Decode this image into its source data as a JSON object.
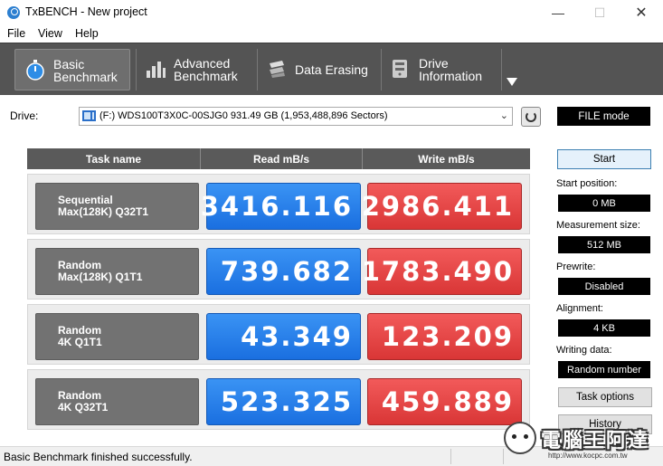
{
  "window": {
    "title": "TxBENCH - New project",
    "min_glyph": "—",
    "max_glyph": "☐",
    "close_glyph": "✕"
  },
  "menu": {
    "items": [
      "File",
      "View",
      "Help"
    ]
  },
  "toolbar": {
    "buttons": [
      {
        "label": "Basic\nBenchmark",
        "icon": "stopwatch-icon",
        "active": true
      },
      {
        "label": "Advanced\nBenchmark",
        "icon": "bar-chart-icon",
        "active": false
      },
      {
        "label": "Data Erasing",
        "icon": "eraser-icon",
        "active": false
      },
      {
        "label": "Drive\nInformation",
        "icon": "drive-info-icon",
        "active": false
      }
    ],
    "more_icon": "chevron-down-icon"
  },
  "drive": {
    "label": "Drive:",
    "selected": "(F:) WDS100T3X0C-00SJG0  931.49 GB (1,953,488,896 Sectors)",
    "mode": "FILE mode"
  },
  "table": {
    "headers": [
      "Task name",
      "Read mB/s",
      "Write mB/s"
    ],
    "rows": [
      {
        "name": "Sequential\nMax(128K) Q32T1",
        "read": "3416.116",
        "write": "2986.411"
      },
      {
        "name": "Random\nMax(128K) Q1T1",
        "read": "739.682",
        "write": "1783.490"
      },
      {
        "name": "Random\n4K Q1T1",
        "read": "43.349",
        "write": "123.209"
      },
      {
        "name": "Random\n4K Q32T1",
        "read": "523.325",
        "write": "459.889"
      }
    ]
  },
  "panel": {
    "start_label": "Start",
    "start_position_label": "Start position:",
    "start_position_value": "0 MB",
    "measurement_size_label": "Measurement size:",
    "measurement_size_value": "512 MB",
    "prewrite_label": "Prewrite:",
    "prewrite_value": "Disabled",
    "alignment_label": "Alignment:",
    "alignment_value": "4 KB",
    "writing_data_label": "Writing data:",
    "writing_data_value": "Random number",
    "task_options_label": "Task options",
    "history_label": "History"
  },
  "status": {
    "text": "Basic Benchmark finished successfully."
  },
  "watermark": {
    "text": "電腦王阿達",
    "url": "http://www.kocpc.com.tw"
  },
  "colors": {
    "read": "#1f78e8",
    "write": "#e04444",
    "toolbar": "#545454"
  }
}
